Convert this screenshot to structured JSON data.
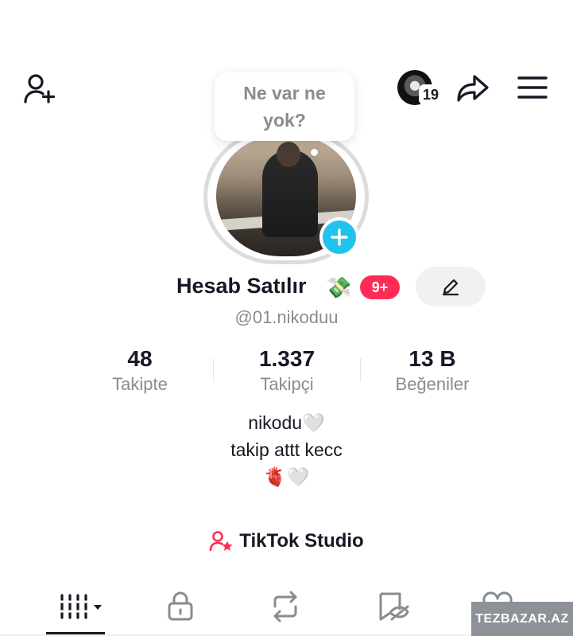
{
  "header": {
    "story_badge_count": "19"
  },
  "note": {
    "text": "Ne var ne yok?"
  },
  "profile": {
    "name": "Hesab Satılır",
    "name_emoji": "💸",
    "notification_badge": "9+",
    "username": "@01.nikoduu"
  },
  "stats": [
    {
      "value": "48",
      "label": "Takipte"
    },
    {
      "value": "1.337",
      "label": "Takipçi"
    },
    {
      "value": "13 B",
      "label": "Beğeniler"
    }
  ],
  "bio": {
    "line1": "nikodu🤍",
    "line2": "takip attt kecc",
    "line3": "🫀🤍"
  },
  "studio": {
    "label": "TikTok Studio"
  },
  "tabs": [
    "videos-grid",
    "private",
    "reposts",
    "favorites",
    "liked"
  ],
  "watermark": "TEZBAZAR.AZ",
  "colors": {
    "accent": "#fe2c55",
    "add_button": "#20c3ed",
    "secondary_text": "#8a8b91"
  }
}
